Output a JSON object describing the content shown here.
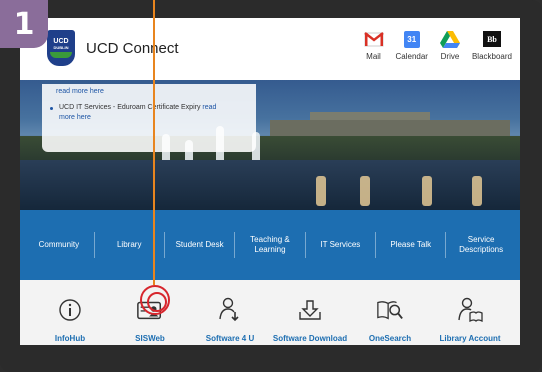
{
  "step": {
    "number": "1"
  },
  "header": {
    "logo_text": "UCD",
    "logo_sub": "DUBLIN",
    "title": "UCD Connect",
    "apps": [
      {
        "label": "Mail",
        "icon": "gmail-icon"
      },
      {
        "label": "Calendar",
        "icon": "calendar-icon"
      },
      {
        "label": "Drive",
        "icon": "drive-icon"
      },
      {
        "label": "Blackboard",
        "icon": "blackboard-icon"
      }
    ],
    "calendar_day": "31",
    "blackboard_glyph": "Bb"
  },
  "news": {
    "first_link": "read more here",
    "item_text": "UCD IT Services - Eduroam Certificate Expiry",
    "item_link_a": "read",
    "item_link_b": "more here"
  },
  "nav": {
    "items": [
      "Community",
      "Library",
      "Student Desk",
      "Teaching &\nLearning",
      "IT Services",
      "Please Talk",
      "Service\nDescriptions"
    ]
  },
  "tools": {
    "items": [
      {
        "label": "InfoHub",
        "icon": "info-icon"
      },
      {
        "label": "SISWeb",
        "icon": "id-card-icon"
      },
      {
        "label": "Software 4 U",
        "icon": "person-download-icon"
      },
      {
        "label": "Software Download",
        "icon": "download-tray-icon"
      },
      {
        "label": "OneSearch",
        "icon": "book-search-icon"
      },
      {
        "label": "Library Account",
        "icon": "person-book-icon"
      }
    ]
  },
  "colors": {
    "brand_blue": "#1d6eb1",
    "indicator": "#e8851f",
    "badge": "#8a6d9a"
  }
}
